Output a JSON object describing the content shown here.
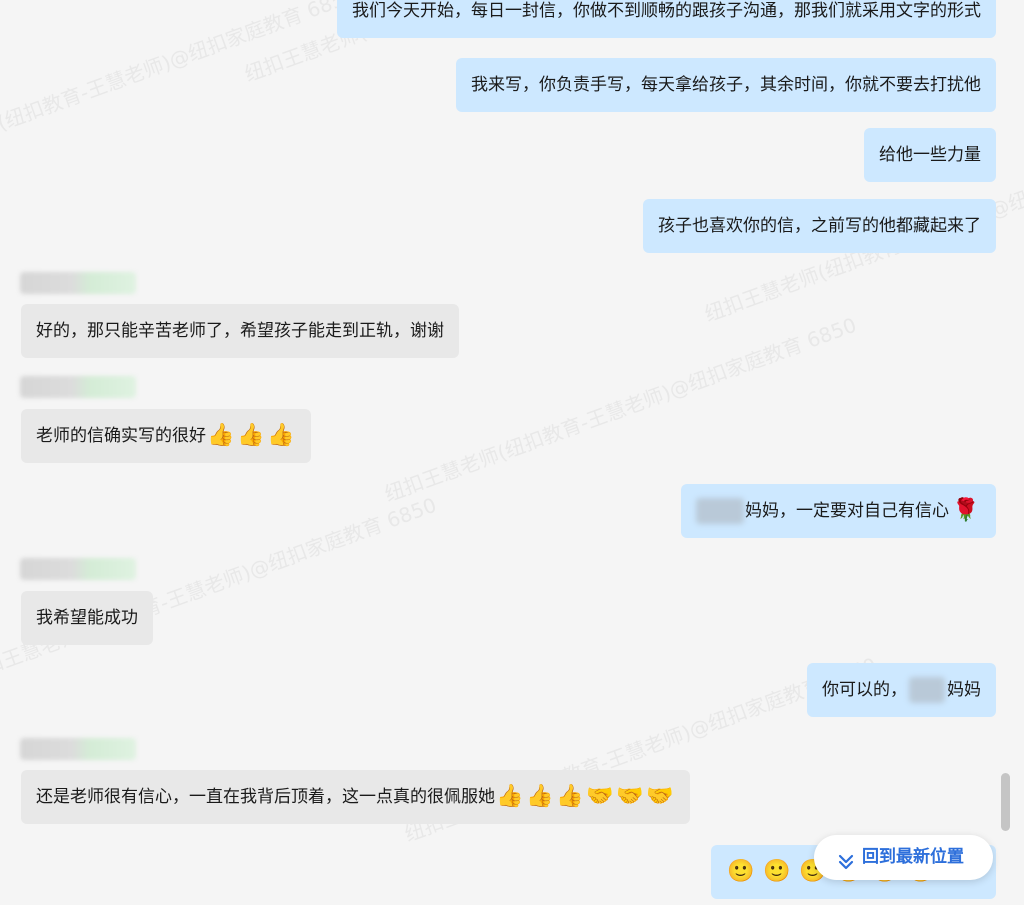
{
  "messages": {
    "m1": "我们今天开始，每日一封信，你做不到顺畅的跟孩子沟通，那我们就采用文字的形式",
    "m2": "我来写，你负责手写，每天拿给孩子，其余时间，你就不要去打扰他",
    "m3": "给他一些力量",
    "m4": "孩子也喜欢你的信，之前写的他都藏起来了",
    "m5": "好的，那只能辛苦老师了，希望孩子能走到正轨，谢谢",
    "m6_text": "老师的信确实写的很好",
    "m6_emoji": [
      "👍",
      "👍",
      "👍"
    ],
    "m7_text": "妈妈，一定要对自己有信心",
    "m7_emoji": "🌹",
    "m8": "我希望能成功",
    "m9_pre": "你可以的，",
    "m9_post": "妈妈",
    "m10_text": "还是老师很有信心，一直在我背后顶着，这一点真的很佩服她",
    "m10_emoji": [
      "👍",
      "👍",
      "👍",
      "🤝",
      "🤝",
      "🤝"
    ],
    "m11_emoji": [
      "🙂",
      "🙂",
      "🙂",
      "🙂",
      "🙂",
      "🙂"
    ]
  },
  "jump_button": {
    "label": "回到最新位置",
    "icon": "double-chevron-down-icon"
  },
  "watermarks": [
    "纽扣王慧老师(纽扣教育-王慧老师)@纽扣家庭教育 6850",
    "纽扣王慧老师(纽扣教育-王慧老师)@纽扣家庭教育 6850",
    "纽扣王慧老师(纽扣教育-王慧老师)@纽扣家庭教育 6850",
    "纽扣王慧老师(纽扣教育-王慧老师)@纽扣家庭教育 6850",
    "纽扣王慧老师(纽扣教育-王慧老师)@纽扣家庭教育 6850",
    "纽扣王慧老师(纽扣教育-王慧老师)@纽扣家庭教育 6850"
  ]
}
